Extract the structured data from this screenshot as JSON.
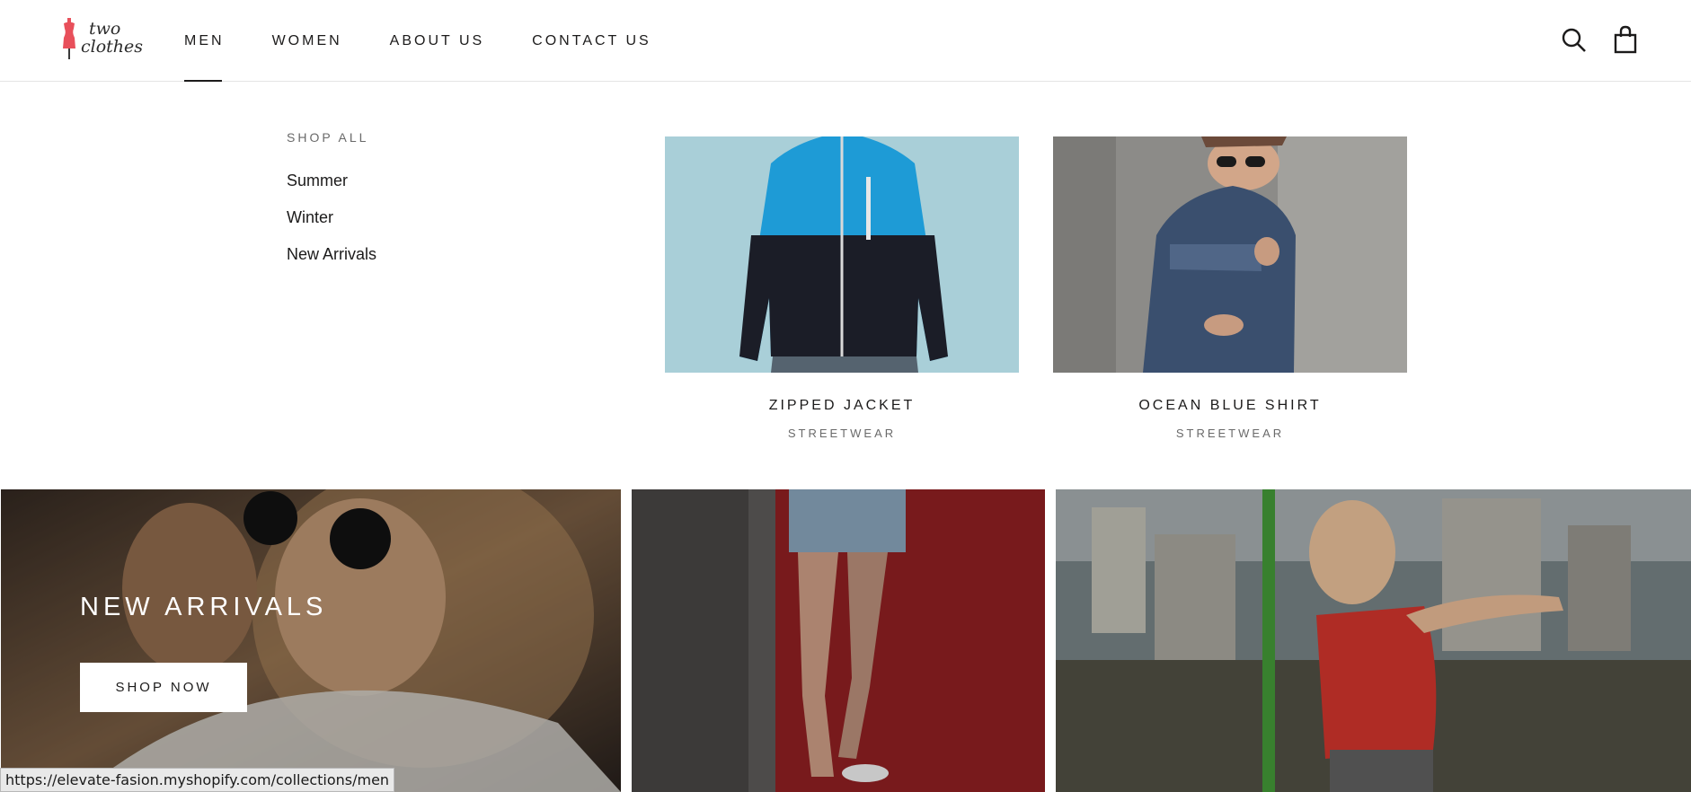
{
  "brand": {
    "line1": "two",
    "line2": "clothes",
    "accent": "#e8505b"
  },
  "nav": [
    {
      "label": "MEN",
      "active": true
    },
    {
      "label": "WOMEN",
      "active": false
    },
    {
      "label": "ABOUT US",
      "active": false
    },
    {
      "label": "CONTACT US",
      "active": false
    }
  ],
  "header_icons": [
    "search-icon",
    "shopping-bag-icon"
  ],
  "mega_menu": {
    "heading": "SHOP ALL",
    "links": [
      "Summer",
      "Winter",
      "New Arrivals"
    ],
    "products": [
      {
        "title": "ZIPPED JACKET",
        "category": "STREETWEAR"
      },
      {
        "title": "OCEAN BLUE SHIRT",
        "category": "STREETWEAR"
      }
    ]
  },
  "banner": {
    "title": "NEW ARRIVALS",
    "cta": "SHOP NOW"
  },
  "status_bar": {
    "url": "https://elevate-fasion.myshopify.com/collections/men"
  }
}
